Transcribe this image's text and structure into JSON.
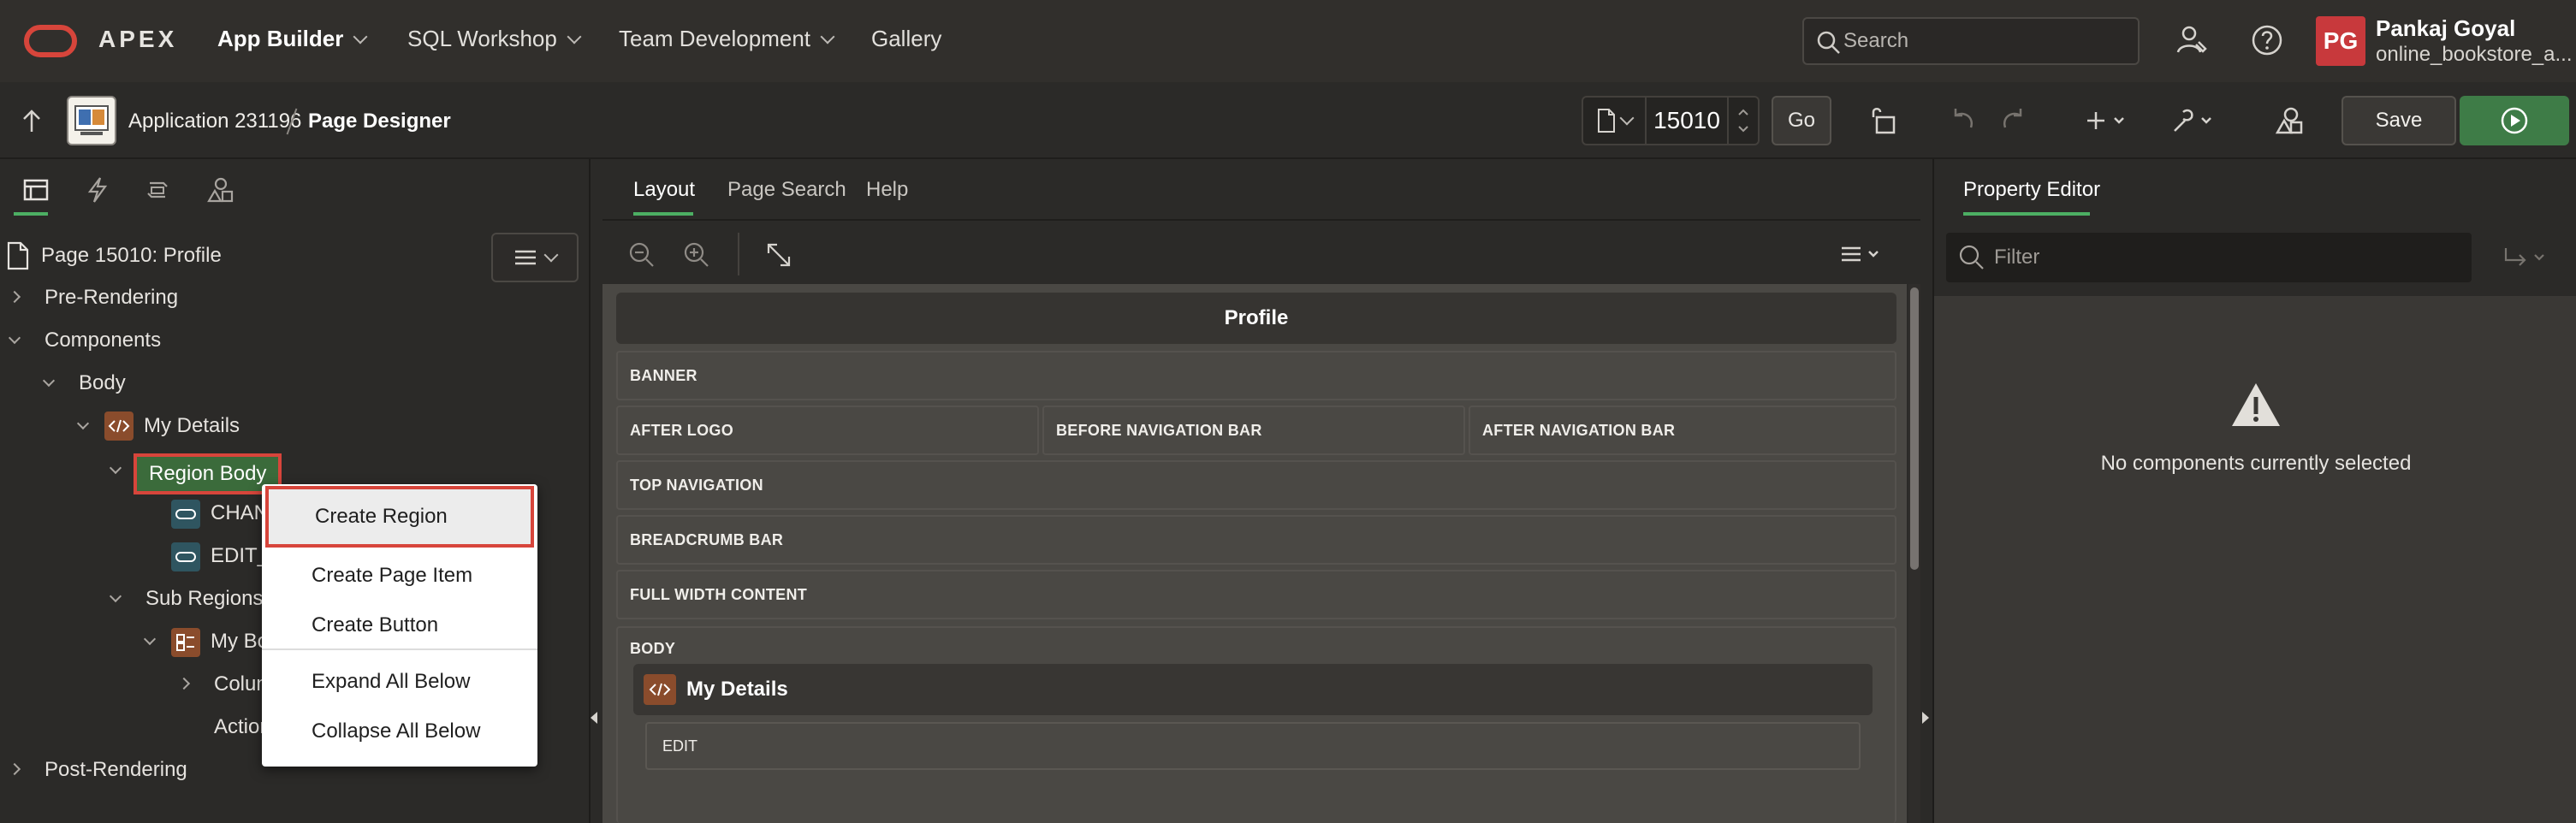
{
  "topnav": {
    "brand": "APEX",
    "items": [
      "App Builder",
      "SQL Workshop",
      "Team Development",
      "Gallery"
    ],
    "search_placeholder": "Search",
    "avatar_initials": "PG",
    "user_name": "Pankaj Goyal",
    "workspace": "online_bookstore_a..."
  },
  "toolbar": {
    "app_name": "Application 231196",
    "current": "Page Designer",
    "page_number": "15010",
    "go_label": "Go",
    "save_label": "Save"
  },
  "left": {
    "page_title": "Page 15010: Profile",
    "tree": {
      "pre_rendering": "Pre-Rendering",
      "components": "Components",
      "body": "Body",
      "my_details": "My Details",
      "region_body": "Region Body",
      "item1": "CHAN",
      "item2": "EDIT_",
      "sub_regions": "Sub Regions",
      "my_bo": "My Bo",
      "column": "Colum",
      "action": "Action",
      "post_rendering": "Post-Rendering"
    },
    "context_menu": {
      "create_region": "Create Region",
      "create_page_item": "Create Page Item",
      "create_button": "Create Button",
      "expand_all": "Expand All Below",
      "collapse_all": "Collapse All Below"
    }
  },
  "center": {
    "tabs": [
      "Layout",
      "Page Search",
      "Help"
    ],
    "page_header": "Profile",
    "slots": {
      "banner": "BANNER",
      "after_logo": "AFTER LOGO",
      "before_nav": "BEFORE NAVIGATION BAR",
      "after_nav": "AFTER NAVIGATION BAR",
      "top_nav": "TOP NAVIGATION",
      "breadcrumb": "BREADCRUMB BAR",
      "full_width": "FULL WIDTH CONTENT",
      "body": "BODY",
      "edit": "EDIT"
    },
    "region_title": "My Details"
  },
  "right": {
    "tab": "Property Editor",
    "filter_placeholder": "Filter",
    "empty_message": "No components currently selected"
  },
  "colors": {
    "accent_green": "#4caf63",
    "highlight_red": "#d7453b",
    "run_green": "#3e7c47",
    "selected_node": "#3b6b3b"
  }
}
